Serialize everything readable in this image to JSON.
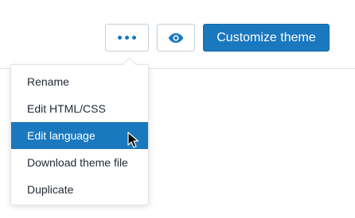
{
  "toolbar": {
    "more_button": {
      "icon": "more-horizontal-icon"
    },
    "preview_button": {
      "icon": "eye-icon"
    },
    "customize_label": "Customize theme"
  },
  "menu": {
    "items": [
      {
        "label": "Rename",
        "active": false
      },
      {
        "label": "Edit HTML/CSS",
        "active": false
      },
      {
        "label": "Edit language",
        "active": true
      },
      {
        "label": "Download theme file",
        "active": false
      },
      {
        "label": "Duplicate",
        "active": false
      }
    ]
  },
  "colors": {
    "primary": "#1a78bf",
    "text": "#212b36",
    "border": "#c4cdd5"
  }
}
